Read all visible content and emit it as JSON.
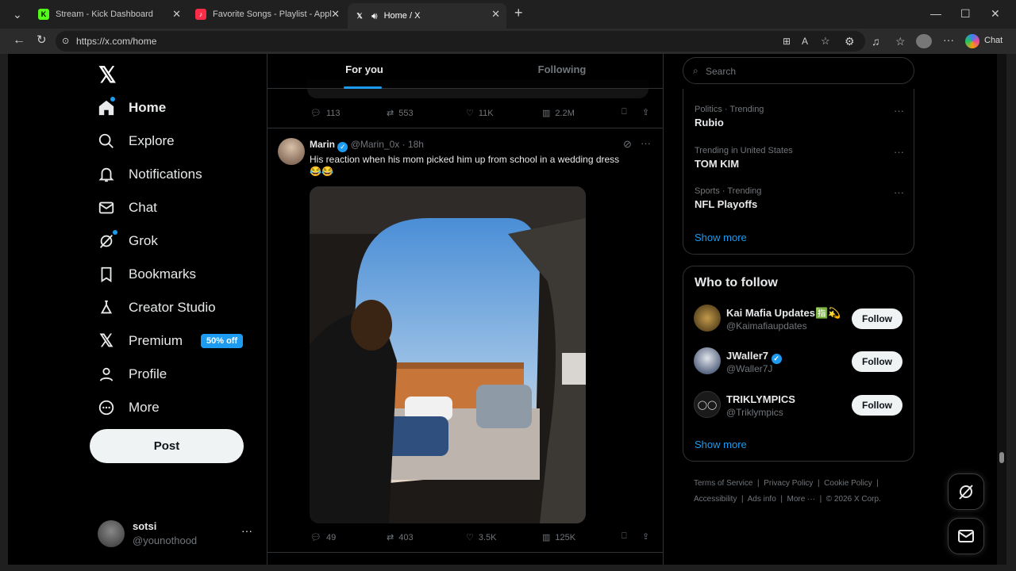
{
  "browser": {
    "tabs": [
      {
        "title": "Stream - Kick Dashboard",
        "fav": "K",
        "fav_color": "#53fc18"
      },
      {
        "title": "Favorite Songs - Playlist - Apple M",
        "fav": "♪",
        "fav_color": "#fa2d48"
      },
      {
        "title": "Home / X",
        "fav": "𝕏",
        "fav_color": "#ffffff"
      }
    ],
    "url": "https://x.com/home",
    "chat_label": "Chat"
  },
  "sidebar": {
    "items": [
      {
        "label": "Home",
        "icon": "home-icon"
      },
      {
        "label": "Explore",
        "icon": "search-icon"
      },
      {
        "label": "Notifications",
        "icon": "bell-icon"
      },
      {
        "label": "Chat",
        "icon": "mail-icon"
      },
      {
        "label": "Grok",
        "icon": "grok-icon"
      },
      {
        "label": "Bookmarks",
        "icon": "bookmark-icon"
      },
      {
        "label": "Creator Studio",
        "icon": "flask-icon"
      },
      {
        "label": "Premium",
        "icon": "x-icon"
      },
      {
        "label": "Profile",
        "icon": "person-icon"
      },
      {
        "label": "More",
        "icon": "more-circle-icon"
      }
    ],
    "premium_badge": "50% off",
    "post_label": "Post",
    "account": {
      "name": "sotsi",
      "handle": "@younothood",
      "more": "···"
    }
  },
  "feed": {
    "tabs": [
      "For you",
      "Following"
    ],
    "prev_post": {
      "replies": "113",
      "reposts": "553",
      "likes": "11K",
      "views": "2.2M"
    },
    "post": {
      "author": "Marin",
      "handle": "@Marin_0x",
      "time": "· 18h",
      "text": "His reaction when his mom picked him up from school in a wedding dress",
      "emoji": "😂😂",
      "replies": "49",
      "reposts": "403",
      "likes": "3.5K",
      "views": "125K"
    }
  },
  "right": {
    "search_placeholder": "Search",
    "trends": [
      {
        "category": "Politics · Trending",
        "name": "Rubio"
      },
      {
        "category": "Trending in United States",
        "name": "TOM KIM"
      },
      {
        "category": "Sports · Trending",
        "name": "NFL Playoffs"
      }
    ],
    "trends_show_more": "Show more",
    "who_to_follow_title": "Who to follow",
    "follow": [
      {
        "name": "Kai Mafia Updates",
        "emoji": "🈯💫",
        "handle": "@Kaimafiaupdates",
        "button": "Follow"
      },
      {
        "name": "JWaller7",
        "handle": "@Waller7J",
        "button": "Follow"
      },
      {
        "name": "TRIKLYMPICS",
        "handle": "@Triklympics",
        "button": "Follow"
      }
    ],
    "follow_show_more": "Show more",
    "footer": {
      "line1": [
        "Terms of Service",
        "Privacy Policy",
        "Cookie Policy"
      ],
      "line2": [
        "Accessibility",
        "Ads info",
        "More ···",
        "© 2026 X Corp."
      ]
    }
  }
}
